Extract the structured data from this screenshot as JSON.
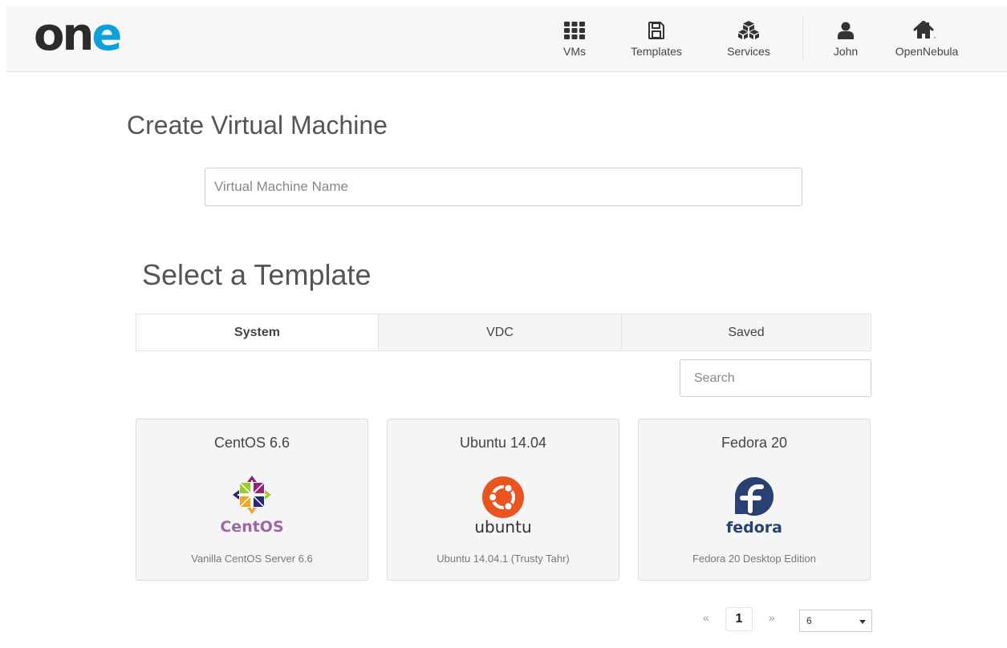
{
  "header": {
    "logo": {
      "part1": "on",
      "part2": "e",
      "colors": {
        "part1": "#2b2b2b",
        "part2": "#0aa1dd"
      }
    },
    "nav": [
      {
        "label": "VMs",
        "icon": "grid-icon"
      },
      {
        "label": "Templates",
        "icon": "floppy-disk-icon"
      },
      {
        "label": "Services",
        "icon": "cubes-icon"
      },
      {
        "label": "John",
        "icon": "user-icon"
      },
      {
        "label": "OpenNebula",
        "icon": "home-icon"
      }
    ]
  },
  "main": {
    "title": "Create Virtual Machine",
    "vm_name_placeholder": "Virtual Machine Name",
    "select_title": "Select a Template",
    "tabs": [
      {
        "label": "System",
        "active": true
      },
      {
        "label": "VDC",
        "active": false
      },
      {
        "label": "Saved",
        "active": false
      }
    ],
    "search_placeholder": "Search",
    "templates": [
      {
        "name": "CentOS 6.6",
        "logo": "centos-logo",
        "logo_text": "CentOS",
        "description": "Vanilla CentOS Server 6.6"
      },
      {
        "name": "Ubuntu 14.04",
        "logo": "ubuntu-logo",
        "logo_text": "ubuntu",
        "description": "Ubuntu 14.04.1 (Trusty Tahr)"
      },
      {
        "name": "Fedora 20",
        "logo": "fedora-logo",
        "logo_text": "fedora",
        "description": "Fedora 20 Desktop Edition"
      }
    ],
    "pagination": {
      "prev": "«",
      "current_page": "1",
      "next": "»",
      "page_size": "6"
    }
  },
  "colors": {
    "accent": "#0aa1dd",
    "ubuntu": "#e95420",
    "fedora": "#294172",
    "centos_text": "#9f65a6"
  }
}
